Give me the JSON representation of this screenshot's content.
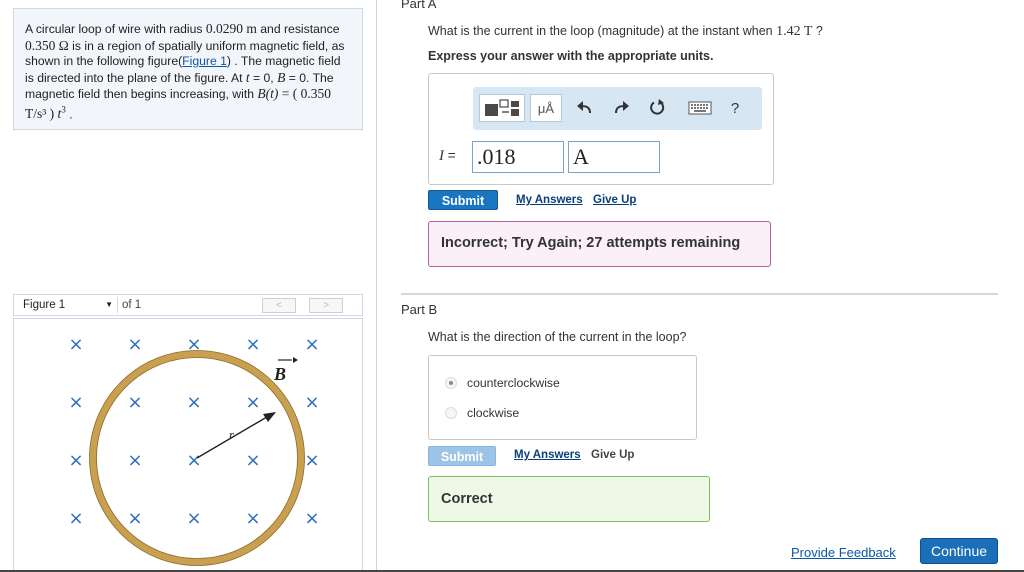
{
  "problem": {
    "text_1": "A circular loop of wire with radius ",
    "radius": "0.0290 m",
    "text_2": " and resistance ",
    "resistance": "0.350 Ω",
    "text_3": " is in a region of spatially uniform magnetic field, as shown in the following figure(",
    "figure_link": "Figure 1",
    "text_4": ") . The magnetic field is directed into the plane of the figure. At ",
    "t_var": "t",
    "text_5": " = 0, ",
    "b_var": "B",
    "text_6": " = 0. The magnetic field then begins increasing, with ",
    "formula_lhs": "B(t)",
    "formula_eq": " = ( 0.350 T/s³ ) ",
    "formula_t": "t",
    "formula_exp": "3",
    "text_7": " ."
  },
  "figure": {
    "selected": "Figure 1",
    "of_label": "of 1",
    "prev": "<",
    "next": ">",
    "field_symbol": "×",
    "b_label": "B",
    "r_label": "r",
    "colors": {
      "field_marks": "#2d6fb6",
      "loop": "#c9a050",
      "loop_fill": "#f2e3bd"
    }
  },
  "partA": {
    "title": "Part A",
    "question_1": "What is the current in the loop (magnitude) at the instant when ",
    "question_value": "1.42 T",
    "question_2": " ?",
    "instruction": "Express your answer with the appropriate units.",
    "toolbar": {
      "units": "μÅ",
      "help": "?"
    },
    "variable_label": "I",
    "equals": " =",
    "value": ".018",
    "unit": "A",
    "submit": "Submit",
    "my_answers": "My Answers",
    "give_up": "Give Up",
    "feedback": "Incorrect; Try Again; 27 attempts remaining"
  },
  "partB": {
    "title": "Part B",
    "question": "What is the direction of the current in the loop?",
    "choices": [
      {
        "label": "counterclockwise",
        "selected": true
      },
      {
        "label": "clockwise",
        "selected": false
      }
    ],
    "submit": "Submit",
    "my_answers": "My Answers",
    "give_up": "Give Up",
    "feedback": "Correct"
  },
  "footer": {
    "provide_feedback": "Provide Feedback",
    "continue": "Continue"
  },
  "colors": {
    "accent": "#1b76c2",
    "incorrect_border": "#b9609d",
    "correct_border": "#7cbf5c"
  }
}
